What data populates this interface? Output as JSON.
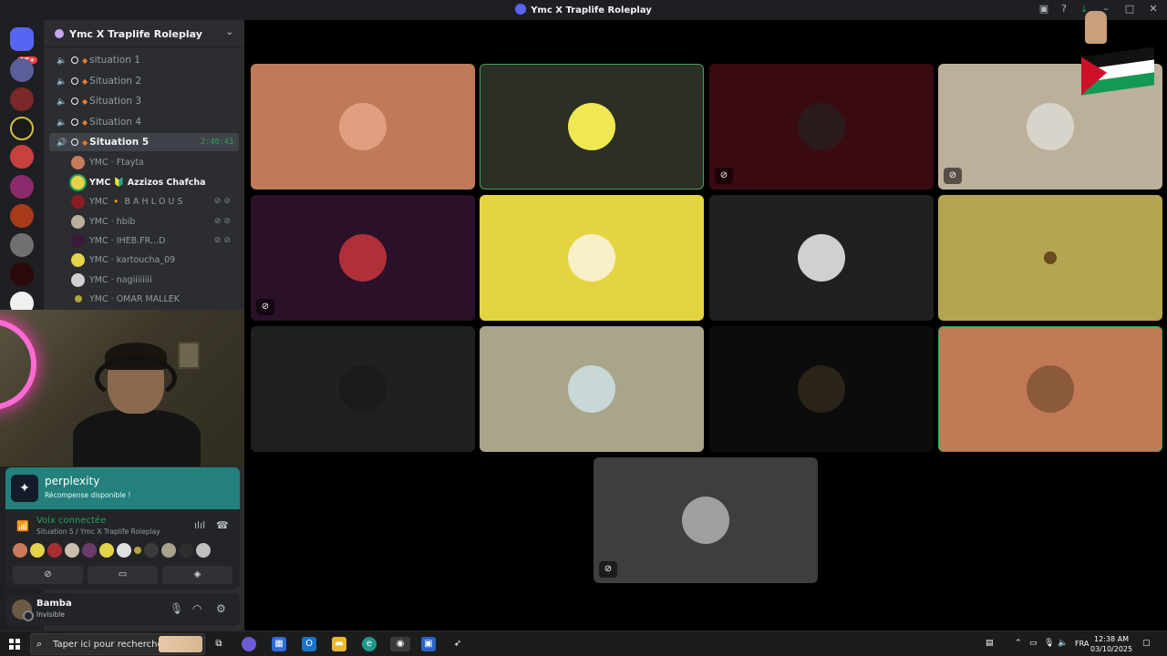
{
  "window": {
    "title": "Ymc X Traplife Roleplay"
  },
  "guild_rail": {
    "badge": "1K+"
  },
  "server": {
    "name": "Ymc X Traplife Roleplay"
  },
  "channels": [
    {
      "name": "situation 1"
    },
    {
      "name": "Situation 2"
    },
    {
      "name": "Situation 3"
    },
    {
      "name": "Situation 4"
    },
    {
      "name": "Situation 5",
      "timer": "2:40:43"
    }
  ],
  "members": [
    {
      "name": "YMC · Ftayta",
      "color": "#c97a5a"
    },
    {
      "name": "YMC 🔰 Azzizos Chafcha",
      "color": "#e5d449"
    },
    {
      "name": "YMC 🔸 B A H L O U S",
      "color": "#8a1d24"
    },
    {
      "name": "YMC · hbib",
      "color": "#bdb09a"
    },
    {
      "name": "YMC · IHEB.FR...D",
      "color": "#3a1a38"
    },
    {
      "name": "YMC · kartoucha_09",
      "color": "#e5d449"
    },
    {
      "name": "YMC · nagiiiiiiii",
      "color": "#d0d0d0"
    },
    {
      "name": "YMC · OMAR MALLEK",
      "color": "#b5a440"
    }
  ],
  "promo": {
    "title": "perplexity",
    "subtitle": "Récompense disponible !"
  },
  "voice": {
    "status": "Voix connectée",
    "channel": "Situation 5 / Ymc X Traplife Roleplay",
    "avatars": [
      "#c97a5a",
      "#e5d449",
      "#a82f2f",
      "#c9c1ad",
      "#6a3b6a",
      "#e5d449",
      "#e0e0e0",
      "#b5a440",
      "#3a3a3a",
      "#a8a38a",
      "#2e2e2e",
      "#c0c0c0"
    ]
  },
  "user": {
    "name": "Bamba",
    "status": "Invisible"
  },
  "tiles": [
    {
      "bg": "#c07a5a",
      "avatar": "#e0a080",
      "speaking": false,
      "deafened": false
    },
    {
      "bg": "#2b2f26",
      "avatar": "#f0e850",
      "speaking": true,
      "deafened": false
    },
    {
      "bg": "#3a0a12",
      "avatar": "#2a1a1a",
      "speaking": false,
      "deafened": true
    },
    {
      "bg": "#bdb09a",
      "avatar": "#d8d4cc",
      "speaking": false,
      "deafened": true
    },
    {
      "bg": "#2a1028",
      "avatar": "#b0303a",
      "speaking": false,
      "deafened": false
    },
    {
      "bg": "#e5d441",
      "avatar": "#f8f0c8",
      "speaking": false,
      "deafened": false
    },
    {
      "bg": "#202020",
      "avatar": "#d0d0d0",
      "speaking": false,
      "deafened": false
    },
    {
      "bg": "#b5a552",
      "avatar": "#b5a552",
      "speaking": false,
      "deafened": false
    },
    {
      "bg": "#202020",
      "avatar": "#1a1a1a",
      "speaking": false,
      "deafened": false
    },
    {
      "bg": "#a8a58a",
      "avatar": "#c8d8d8",
      "speaking": false,
      "deafened": false
    },
    {
      "bg": "#0c0c0c",
      "avatar": "#2a2418",
      "speaking": false,
      "deafened": false
    },
    {
      "bg": "#c07a55",
      "avatar": "#8a5a3a",
      "speaking": true,
      "deafened": false
    },
    {
      "bg": "#3e3e3e",
      "avatar": "#a0a0a0",
      "speaking": false,
      "deafened": false,
      "muted": true
    }
  ],
  "taskbar": {
    "search_placeholder": "Taper ici pour rechercher",
    "lang": "FRA",
    "time": "12:38 AM",
    "date": "03/10/2025"
  },
  "colors": {
    "accent": "#5865f2",
    "online": "#23a559",
    "speaking_outline": "#3ba55c"
  }
}
